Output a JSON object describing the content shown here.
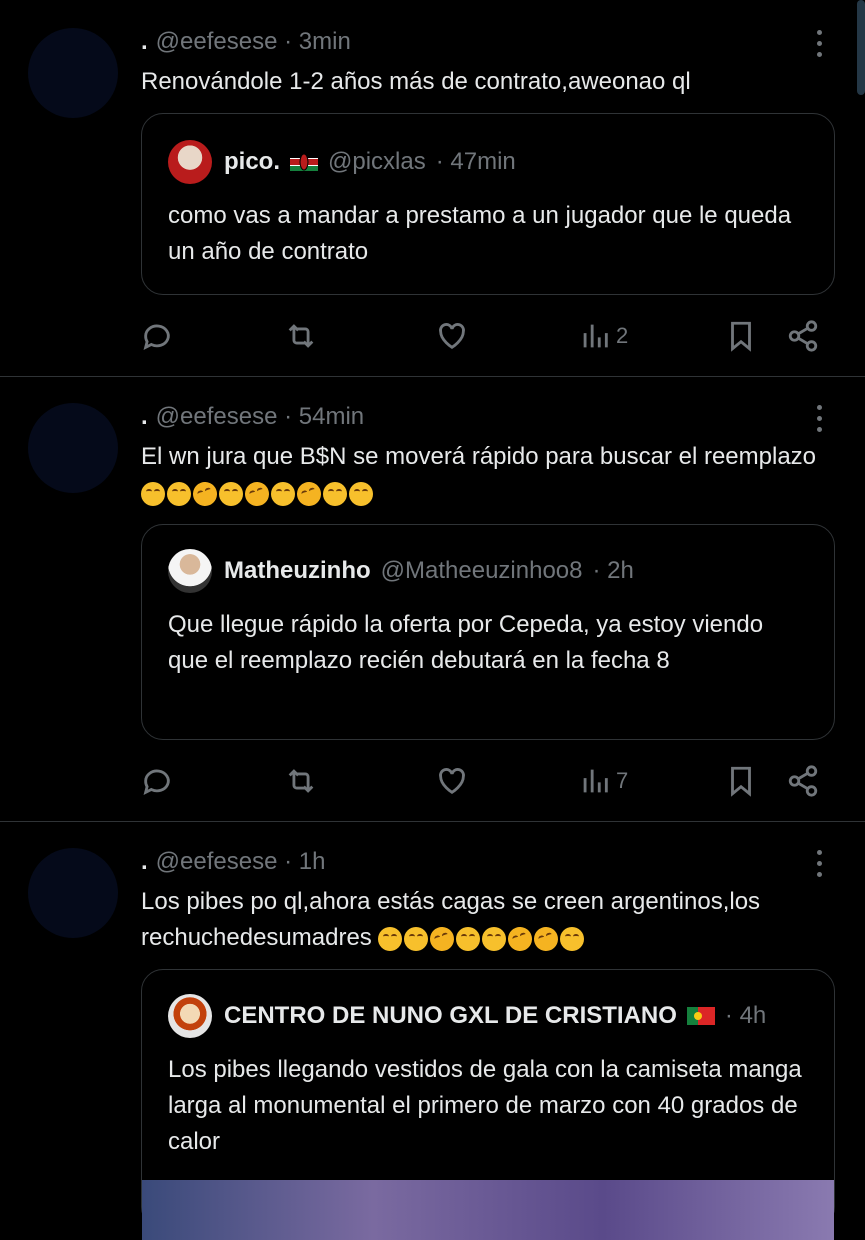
{
  "tweets": [
    {
      "dot": ".",
      "handle": "@eefesese",
      "time": "· 3min",
      "text": "Renovándole 1-2 años más de contrato,aweonao ql",
      "emojis": "",
      "quote": {
        "name": "pico.",
        "flag": "kenya-flag",
        "handle": "@picxlas",
        "time": "· 47min",
        "text": "como vas a mandar a prestamo a un jugador que le queda un año de contrato"
      },
      "views": "2"
    },
    {
      "dot": ".",
      "handle": "@eefesese",
      "time": "· 54min",
      "text": "El wn jura que B$N se moverá rápido para buscar el reemplazo",
      "emojis": "😂😂🤣😂🤣😂🤣😂😂",
      "quote": {
        "name": "Matheuzinho",
        "handle": "@Matheeuzinhoo8",
        "time": "· 2h",
        "text": "Que llegue rápido la oferta por Cepeda, ya estoy viendo que el reemplazo recién debutará en la fecha 8"
      },
      "views": "7"
    },
    {
      "dot": ".",
      "handle": "@eefesese",
      "time": "· 1h",
      "text": "Los pibes po ql,ahora estás cagas se creen argentinos,los rechuchedesumadres",
      "emojis": "😂😂🤣😂😂🤣🤣😂",
      "quote": {
        "name": "CENTRO DE NUNO GXL DE CRISTIANO",
        "flag": "portugal-flag",
        "handle": "",
        "time": "· 4h",
        "text": "Los pibes llegando vestidos de gala con la camiseta manga larga al monumental el primero de marzo con 40 grados de calor"
      }
    }
  ],
  "colors": {
    "bg": "#000000",
    "text": "#e7e9ea",
    "muted": "#71767b",
    "border": "#2f3336"
  },
  "icons": [
    "reply-icon",
    "retweet-icon",
    "like-icon",
    "views-icon",
    "bookmark-icon",
    "share-icon",
    "more-icon"
  ]
}
